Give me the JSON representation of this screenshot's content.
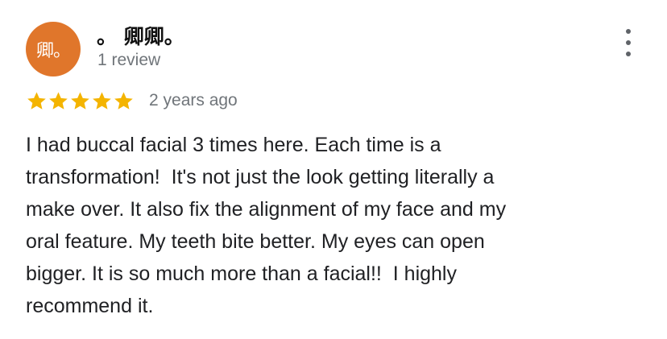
{
  "review": {
    "avatar_text": "卿。",
    "author_name": "。 卿卿。",
    "review_count": "1 review",
    "rating": 5,
    "rating_max": 5,
    "date": "2 years ago",
    "text": "I had buccal facial 3 times here. Each time is a\ntransformation!  It's not just the look getting literally a\nmake over. It also fix the alignment of my face and my\noral feature. My teeth bite better. My eyes can open\nbigger. It is so much more than a facial!!  I highly\nrecommend it.",
    "more_icon": "more-vert-icon",
    "star_icon": "star-icon"
  },
  "colors": {
    "avatar_bg": "#e0762b",
    "star": "#f4b400",
    "secondary_text": "#70757a",
    "primary_text": "#202124"
  }
}
